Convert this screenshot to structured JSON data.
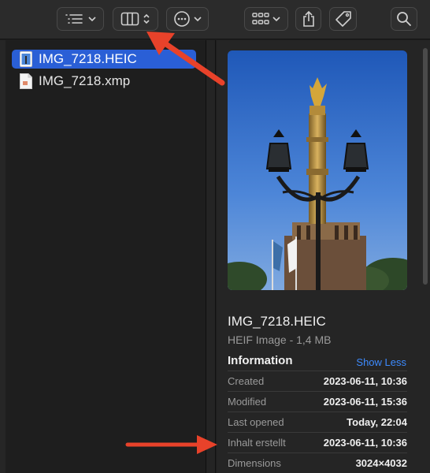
{
  "toolbar": {
    "buttons": [
      {
        "icon": "list-view-icon"
      },
      {
        "icon": "column-view-icon"
      },
      {
        "icon": "more-actions-icon"
      },
      {
        "icon": "group-by-icon"
      },
      {
        "icon": "share-icon"
      },
      {
        "icon": "tag-icon"
      },
      {
        "icon": "search-icon"
      }
    ]
  },
  "files": [
    {
      "name": "IMG_7218.HEIC",
      "selected": true
    },
    {
      "name": "IMG_7218.xmp",
      "selected": false
    }
  ],
  "preview": {
    "file_name": "IMG_7218.HEIC",
    "file_kind": "HEIF Image - 1,4 MB",
    "info_heading": "Information",
    "show_less": "Show Less",
    "rows": [
      {
        "key": "Created",
        "value": "2023-06-11, 10:36"
      },
      {
        "key": "Modified",
        "value": "2023-06-11, 15:36"
      },
      {
        "key": "Last opened",
        "value": "Today, 22:04"
      },
      {
        "key": "Inhalt erstellt",
        "value": "2023-06-11, 10:36"
      },
      {
        "key": "Dimensions",
        "value": "3024×4032"
      }
    ]
  },
  "colors": {
    "selection": "#2a5fd6",
    "link": "#3d8bff",
    "annotation": "#e8422a"
  }
}
